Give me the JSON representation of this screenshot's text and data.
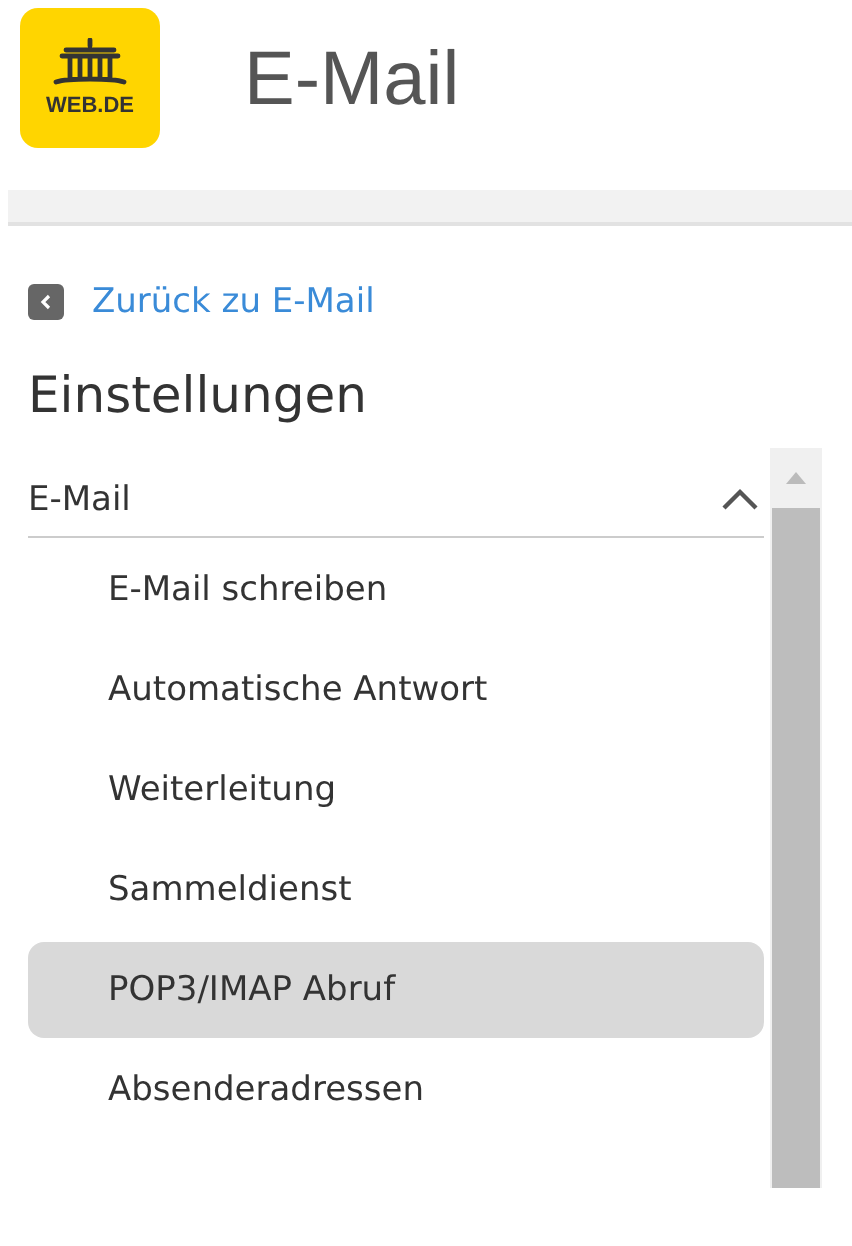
{
  "header": {
    "logo_text": "WEB.DE",
    "title": "E-Mail"
  },
  "back_link": {
    "label": "Zurück zu E-Mail"
  },
  "page_title": "Einstellungen",
  "section": {
    "label": "E-Mail",
    "expanded": true,
    "items": [
      {
        "label": "E-Mail schreiben",
        "selected": false
      },
      {
        "label": "Automatische Antwort",
        "selected": false
      },
      {
        "label": "Weiterleitung",
        "selected": false
      },
      {
        "label": "Sammeldienst",
        "selected": false
      },
      {
        "label": "POP3/IMAP Abruf",
        "selected": true
      },
      {
        "label": "Absenderadressen",
        "selected": false
      }
    ]
  }
}
